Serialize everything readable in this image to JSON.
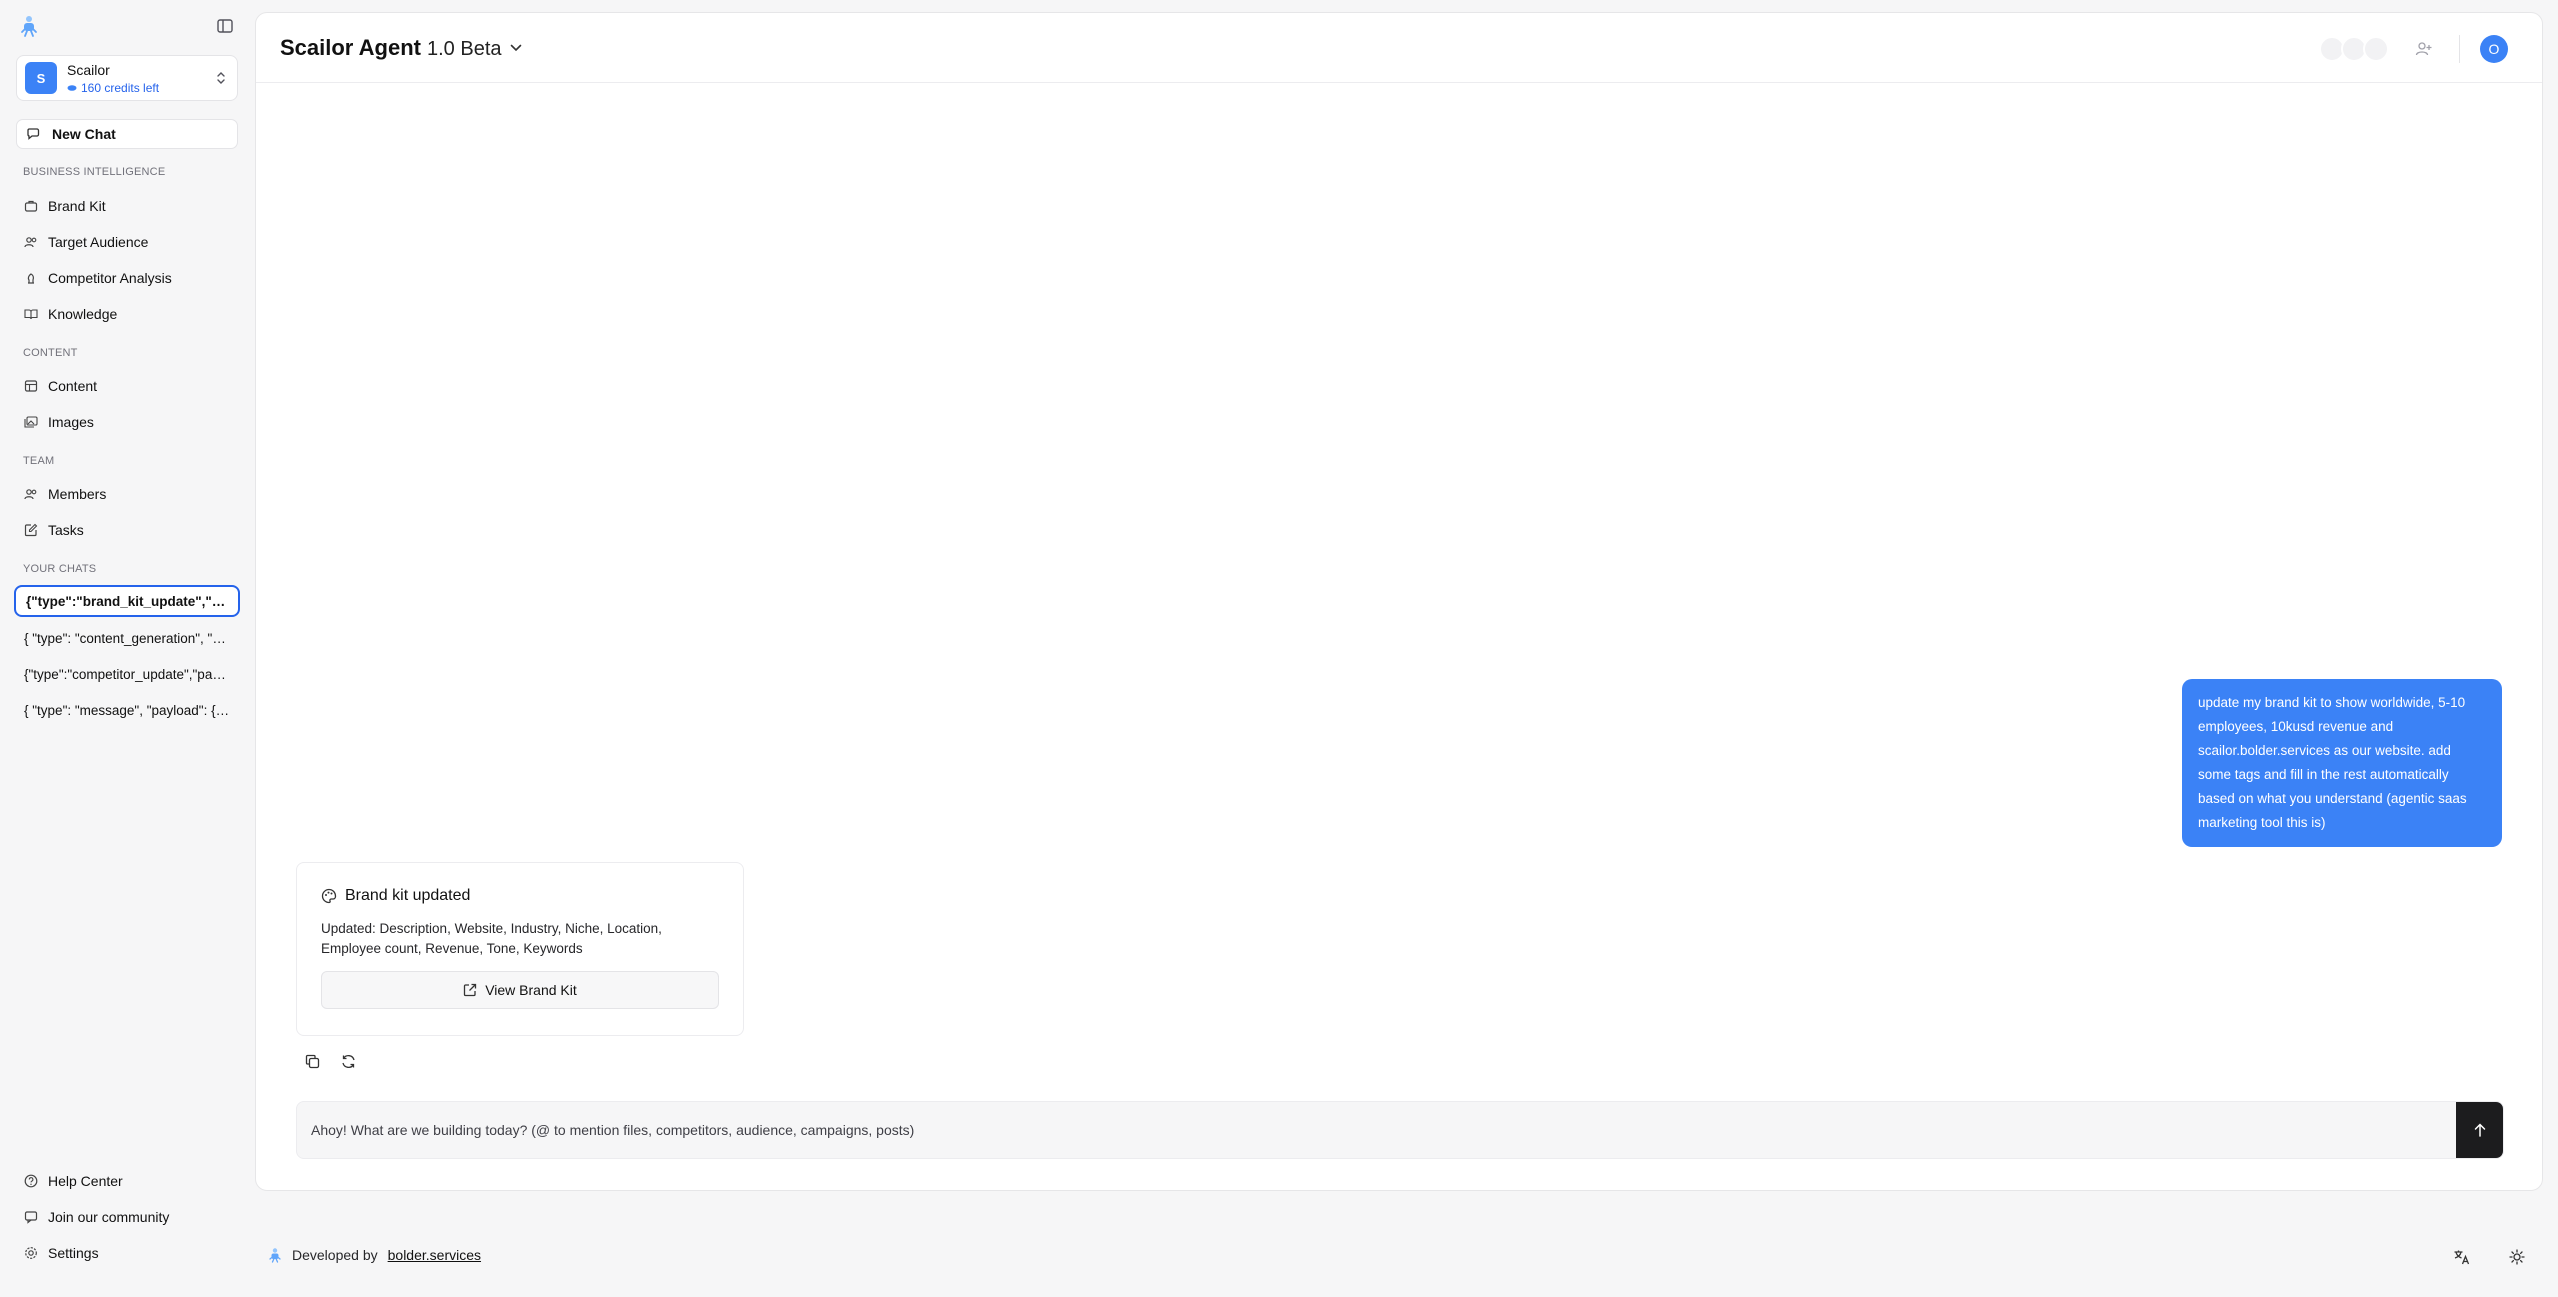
{
  "sidebar": {
    "org": {
      "initial": "S",
      "name": "Scailor",
      "credits": "160 credits left"
    },
    "new_chat": "New Chat",
    "sections": {
      "business": "BUSINESS INTELLIGENCE",
      "content": "CONTENT",
      "team": "TEAM",
      "chats": "YOUR CHATS"
    },
    "items": {
      "brand_kit": "Brand Kit",
      "target_audience": "Target Audience",
      "competitor_analysis": "Competitor Analysis",
      "knowledge": "Knowledge",
      "content": "Content",
      "images": "Images",
      "members": "Members",
      "tasks": "Tasks"
    },
    "chats": [
      "{\"type\":\"brand_kit_update\",\"payload\":{",
      "{ \"type\": \"content_generation\", \"payload\": {",
      "{\"type\":\"competitor_update\",\"payload\":{",
      "{ \"type\": \"message\", \"payload\": { \"text\""
    ],
    "footer": {
      "help": "Help Center",
      "community": "Join our community",
      "settings": "Settings"
    }
  },
  "header": {
    "model_name": "Scailor Agent",
    "model_version": "1.0 Beta",
    "user_initial": "O"
  },
  "conversation": {
    "user_message": "update my brand kit to show worldwide, 5-10 employees, 10kusd revenue and scailor.bolder.services as our website. add some tags and fill in the rest automatically based on what you understand (agentic saas marketing tool this is)",
    "card": {
      "title": "Brand kit updated",
      "description": "Updated: Description, Website, Industry, Niche, Location, Employee count, Revenue, Tone, Keywords",
      "button": "View Brand Kit"
    }
  },
  "composer": {
    "placeholder": "Ahoy! What are we building today? (@ to mention files, competitors, audience, campaigns, posts)",
    "value": ""
  },
  "footer": {
    "developed_by": "Developed by",
    "developer": "bolder.services"
  },
  "colors": {
    "accent": "#3b82f6",
    "accent_text": "#2563eb",
    "send_button": "#1c1c1e"
  }
}
